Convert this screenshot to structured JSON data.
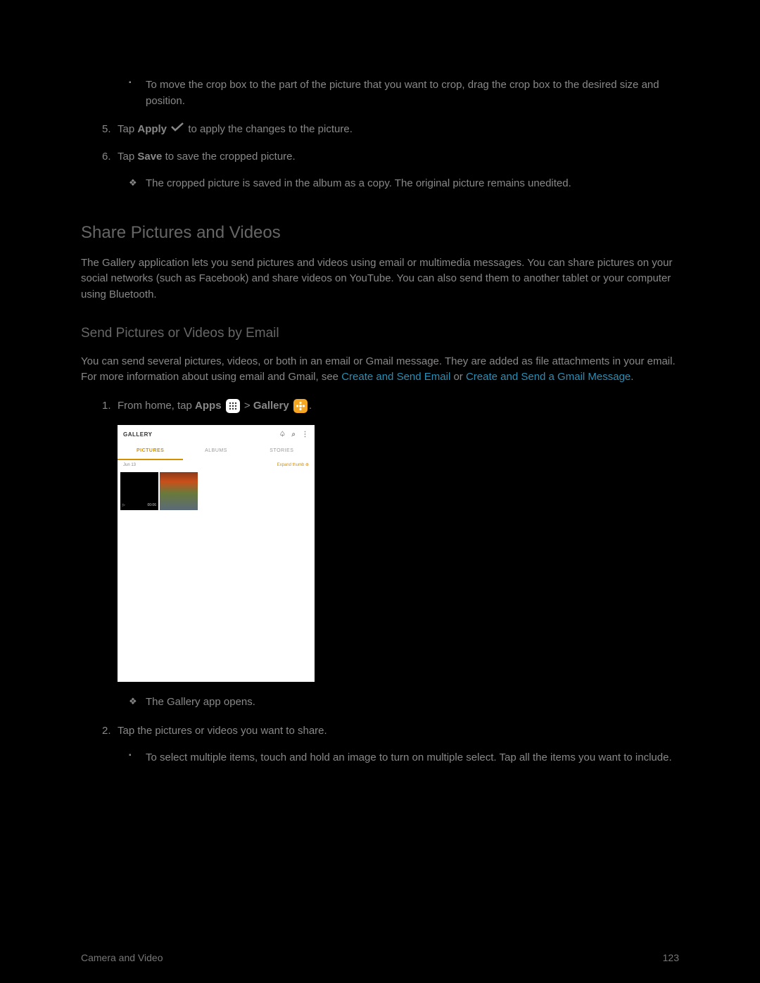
{
  "list": {
    "crop_move": "To move the crop box to the part of the picture that you want to crop, drag the crop box to the desired size and position.",
    "step5_num": "5.",
    "step5_pre": "Tap ",
    "step5_bold": "Apply",
    "step5_post": " to apply the changes to the picture.",
    "step6_num": "6.",
    "step6_pre": "Tap ",
    "step6_bold": "Save",
    "step6_post": " to save the cropped picture.",
    "step6_note": "The cropped picture is saved in the album as a copy. The original picture remains unedited."
  },
  "section1": {
    "title": "Share Pictures and Videos",
    "body": "The Gallery application lets you send pictures and videos using email or multimedia messages. You can share pictures on your social networks (such as Facebook) and share videos on YouTube. You can also send them to another tablet or your computer using Bluetooth."
  },
  "section2": {
    "title": "Send Pictures or Videos by Email",
    "body_pre": "You can send several pictures, videos, or both in an email or Gmail message. They are added as file attachments in your email. For more information about using email and Gmail, see ",
    "link1": "Create and Send Email",
    "mid": " or ",
    "link2": "Create and Send a Gmail Message",
    "body_post": "."
  },
  "steps": {
    "s1_num": "1.",
    "s1_pre": "From home, tap ",
    "s1_apps": "Apps",
    "s1_gt": " > ",
    "s1_gallery": "Gallery",
    "s1_post": ".",
    "s1_note": "The Gallery app opens.",
    "s2_num": "2.",
    "s2_text": "Tap the pictures or videos you want to share.",
    "s2_sub": "To select multiple items, touch and hold an image to turn on multiple select. Tap all the items you want to include."
  },
  "gallery": {
    "title": "GALLERY",
    "tab1": "PICTURES",
    "tab2": "ALBUMS",
    "tab3": "STORIES",
    "date": "Jun 13",
    "expand": "Expand thumb ⊕",
    "vid_time": "00:06"
  },
  "footer": {
    "section": "Camera and Video",
    "page": "123"
  }
}
